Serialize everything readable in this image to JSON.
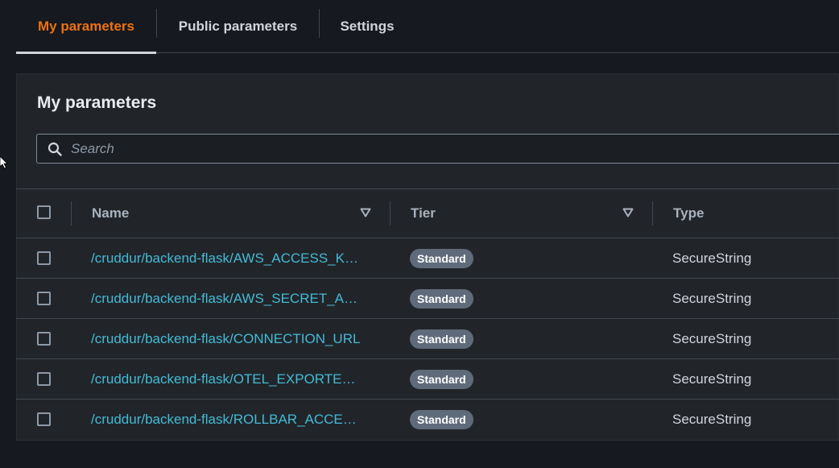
{
  "tabs": [
    {
      "label": "My parameters",
      "active": true
    },
    {
      "label": "Public parameters",
      "active": false
    },
    {
      "label": "Settings",
      "active": false
    }
  ],
  "panel": {
    "title": "My parameters",
    "search_placeholder": "Search"
  },
  "table": {
    "columns": [
      "Name",
      "Tier",
      "Type"
    ],
    "rows": [
      {
        "name": "/cruddur/backend-flask/AWS_ACCESS_K…",
        "tier": "Standard",
        "type": "SecureString"
      },
      {
        "name": "/cruddur/backend-flask/AWS_SECRET_A…",
        "tier": "Standard",
        "type": "SecureString"
      },
      {
        "name": "/cruddur/backend-flask/CONNECTION_URL",
        "tier": "Standard",
        "type": "SecureString"
      },
      {
        "name": "/cruddur/backend-flask/OTEL_EXPORTE…",
        "tier": "Standard",
        "type": "SecureString"
      },
      {
        "name": "/cruddur/backend-flask/ROLLBAR_ACCE…",
        "tier": "Standard",
        "type": "SecureString"
      }
    ]
  },
  "colors": {
    "background": "#16191f",
    "panel": "#212529",
    "accent": "#ec7211",
    "link": "#44b9d6",
    "badge": "#5f6b7a"
  },
  "icons": [
    "search-icon",
    "sort-down-icon",
    "mouse-cursor-icon"
  ]
}
